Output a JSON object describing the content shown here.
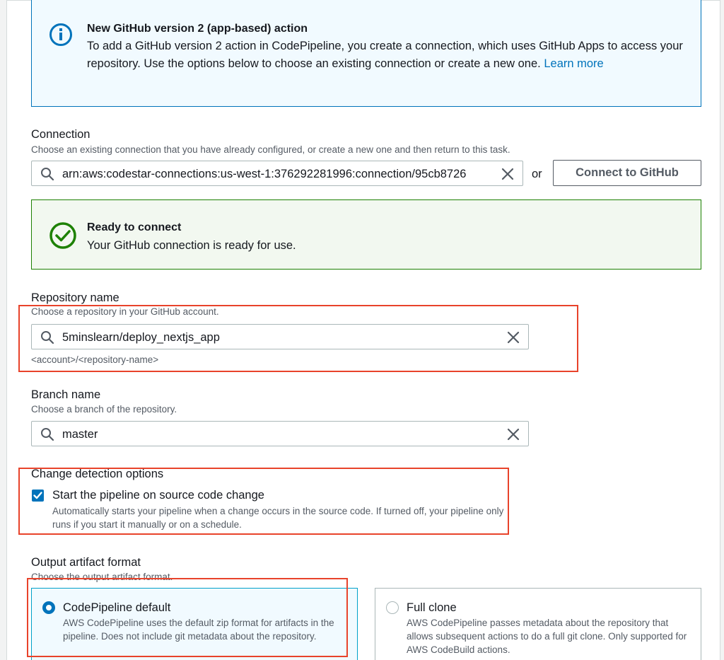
{
  "info_alert": {
    "title": "New GitHub version 2 (app-based) action",
    "body": "To add a GitHub version 2 action in CodePipeline, you create a connection, which uses GitHub Apps to access your repository. Use the options below to choose an existing connection or create a new one.",
    "link_label": "Learn more",
    "icon": "info-icon"
  },
  "connection": {
    "label": "Connection",
    "description": "Choose an existing connection that you have already configured, or create a new one and then return to this task.",
    "value": "arn:aws:codestar-connections:us-west-1:376292281996:connection/95cb8726",
    "or_label": "or",
    "connect_button_label": "Connect to GitHub"
  },
  "success_alert": {
    "title": "Ready to connect",
    "body": "Your GitHub connection is ready for use.",
    "icon": "check-circle-icon"
  },
  "repository": {
    "label": "Repository name",
    "description": "Choose a repository in your GitHub account.",
    "value": "5minslearn/deploy_nextjs_app",
    "constraint": "<account>/<repository-name>"
  },
  "branch": {
    "label": "Branch name",
    "description": "Choose a branch of the repository.",
    "value": "master"
  },
  "change_detection": {
    "label": "Change detection options",
    "checkbox_label": "Start the pipeline on source code change",
    "checkbox_checked": true,
    "checkbox_description": "Automatically starts your pipeline when a change occurs in the source code. If turned off, your pipeline only runs if you start it manually or on a schedule."
  },
  "output_format": {
    "label": "Output artifact format",
    "description": "Choose the output artifact format.",
    "options": [
      {
        "title": "CodePipeline default",
        "description": "AWS CodePipeline uses the default zip format for artifacts in the pipeline. Does not include git metadata about the repository.",
        "selected": true
      },
      {
        "title": "Full clone",
        "description": "AWS CodePipeline passes metadata about the repository that allows subsequent actions to do a full git clone. Only supported for AWS CodeBuild actions.",
        "selected": false
      }
    ]
  },
  "colors": {
    "link": "#0073bb",
    "info_border": "#0073bb",
    "success_border": "#1d8102",
    "highlight_red": "#e8432b",
    "primary_blue": "#0073bb"
  }
}
